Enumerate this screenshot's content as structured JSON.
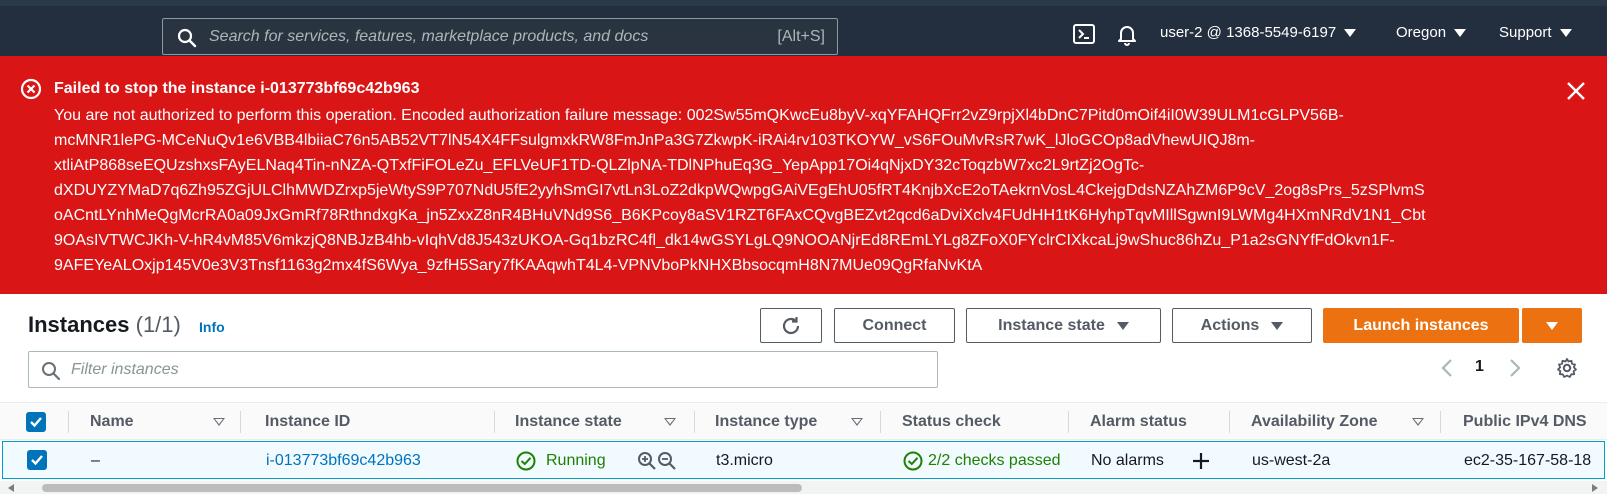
{
  "topnav": {
    "search_placeholder": "Search for services, features, marketplace products, and docs",
    "search_shortcut": "[Alt+S]",
    "account": "user-2 @ 1368-5549-6197",
    "region": "Oregon",
    "support": "Support",
    "icons": [
      "search-icon",
      "cloudshell-icon",
      "bell-icon"
    ]
  },
  "flash": {
    "type": "error",
    "title": "Failed to stop the instance i-013773bf69c42b963",
    "message_lines": [
      "You are not authorized to perform this operation. Encoded authorization failure message: 002Sw55mQKwcEu8byV-xqYFAHQFrr2vZ9rpjXl4bDnC7Pitd0mOif4iI0W39ULM1cGLPV56B-",
      "mcMNR1lePG-MCeNuQv1e6VBB4lbiiaC76n5AB52VT7lN54X4FFsulgmxkRW8FmJnPa3G7ZkwpK-iRAi4rv103TKOYW_vS6FOuMvRsR7wK_lJloGCOp8adVhewUIQJ8m-",
      "xtliAtP868seEQUzshxsFAyELNaq4Tin-nNZA-QTxfFiFOLeZu_EFLVeUF1TD-QLZlpNA-TDlNPhuEq3G_YepApp17Oi4qNjxDY32cToqzbW7xc2L9rtZj2OgTc-",
      "dXDUYZYMaD7q6Zh95ZGjULClhMWDZrxp5jeWtyS9P707NdU5fE2yyhSmGI7vtLn3LoZ2dkpWQwpgGAiVEgEhU05fRT4KnjbXcE2oTAekrnVosL4CkejgDdsNZAhZM6P9cV_2og8sPrs_5zSPlvmS",
      "oACntLYnhMeQgMcrRA0a09JxGmRf78RthndxgKa_jn5ZxxZ8nR4BHuVNd9S6_B6KPcoy8aSV1RZT6FAxCQvgBEZvt2qcd6aDviXclv4FUdHH1tK6HyhpTqvMIllSgwnI9LWMg4HXmNRdV1N1_Cbt",
      "9OAsIVTWCJKh-V-hR4vM85V6mkzjQ8NBJzB4hb-vIqhVd8J543zUKOA-Gq1bzRC4fl_dk14wGSYLgLQ9NOOANjrEd8REmLYLg8ZFoX0FYclrCIXkcaLj9wShuc86hZu_P1a2sGNYfFdOkvn1F-",
      "9AFEYeALOxjp145V0e3V3Tnsf1163g2mx4fS6Wya_9zfH5Sary7fKAAqwhT4L4-VPNVboPkNHXBbsocqmH8N7MUe09QgRfaNvKtA"
    ],
    "color": "#d91515"
  },
  "instances_panel": {
    "title": "Instances",
    "count": "(1/1)",
    "info_label": "Info",
    "buttons": {
      "refresh_icon": "refresh-icon",
      "connect": "Connect",
      "instance_state": "Instance state",
      "actions": "Actions",
      "launch": "Launch instances"
    },
    "filter_placeholder": "Filter instances",
    "page_number": "1",
    "accent": "#ec7211"
  },
  "table": {
    "columns": [
      "Name",
      "Instance ID",
      "Instance state",
      "Instance type",
      "Status check",
      "Alarm status",
      "Availability Zone",
      "Public IPv4 DNS"
    ],
    "rows": [
      {
        "selected": true,
        "name": "–",
        "instance_id": "i-013773bf69c42b963",
        "instance_state": "Running",
        "instance_type": "t3.micro",
        "status_check": "2/2 checks passed",
        "alarm_status": "No alarms",
        "availability_zone": "us-west-2a",
        "public_dns": "ec2-35-167-58-18"
      }
    ]
  }
}
